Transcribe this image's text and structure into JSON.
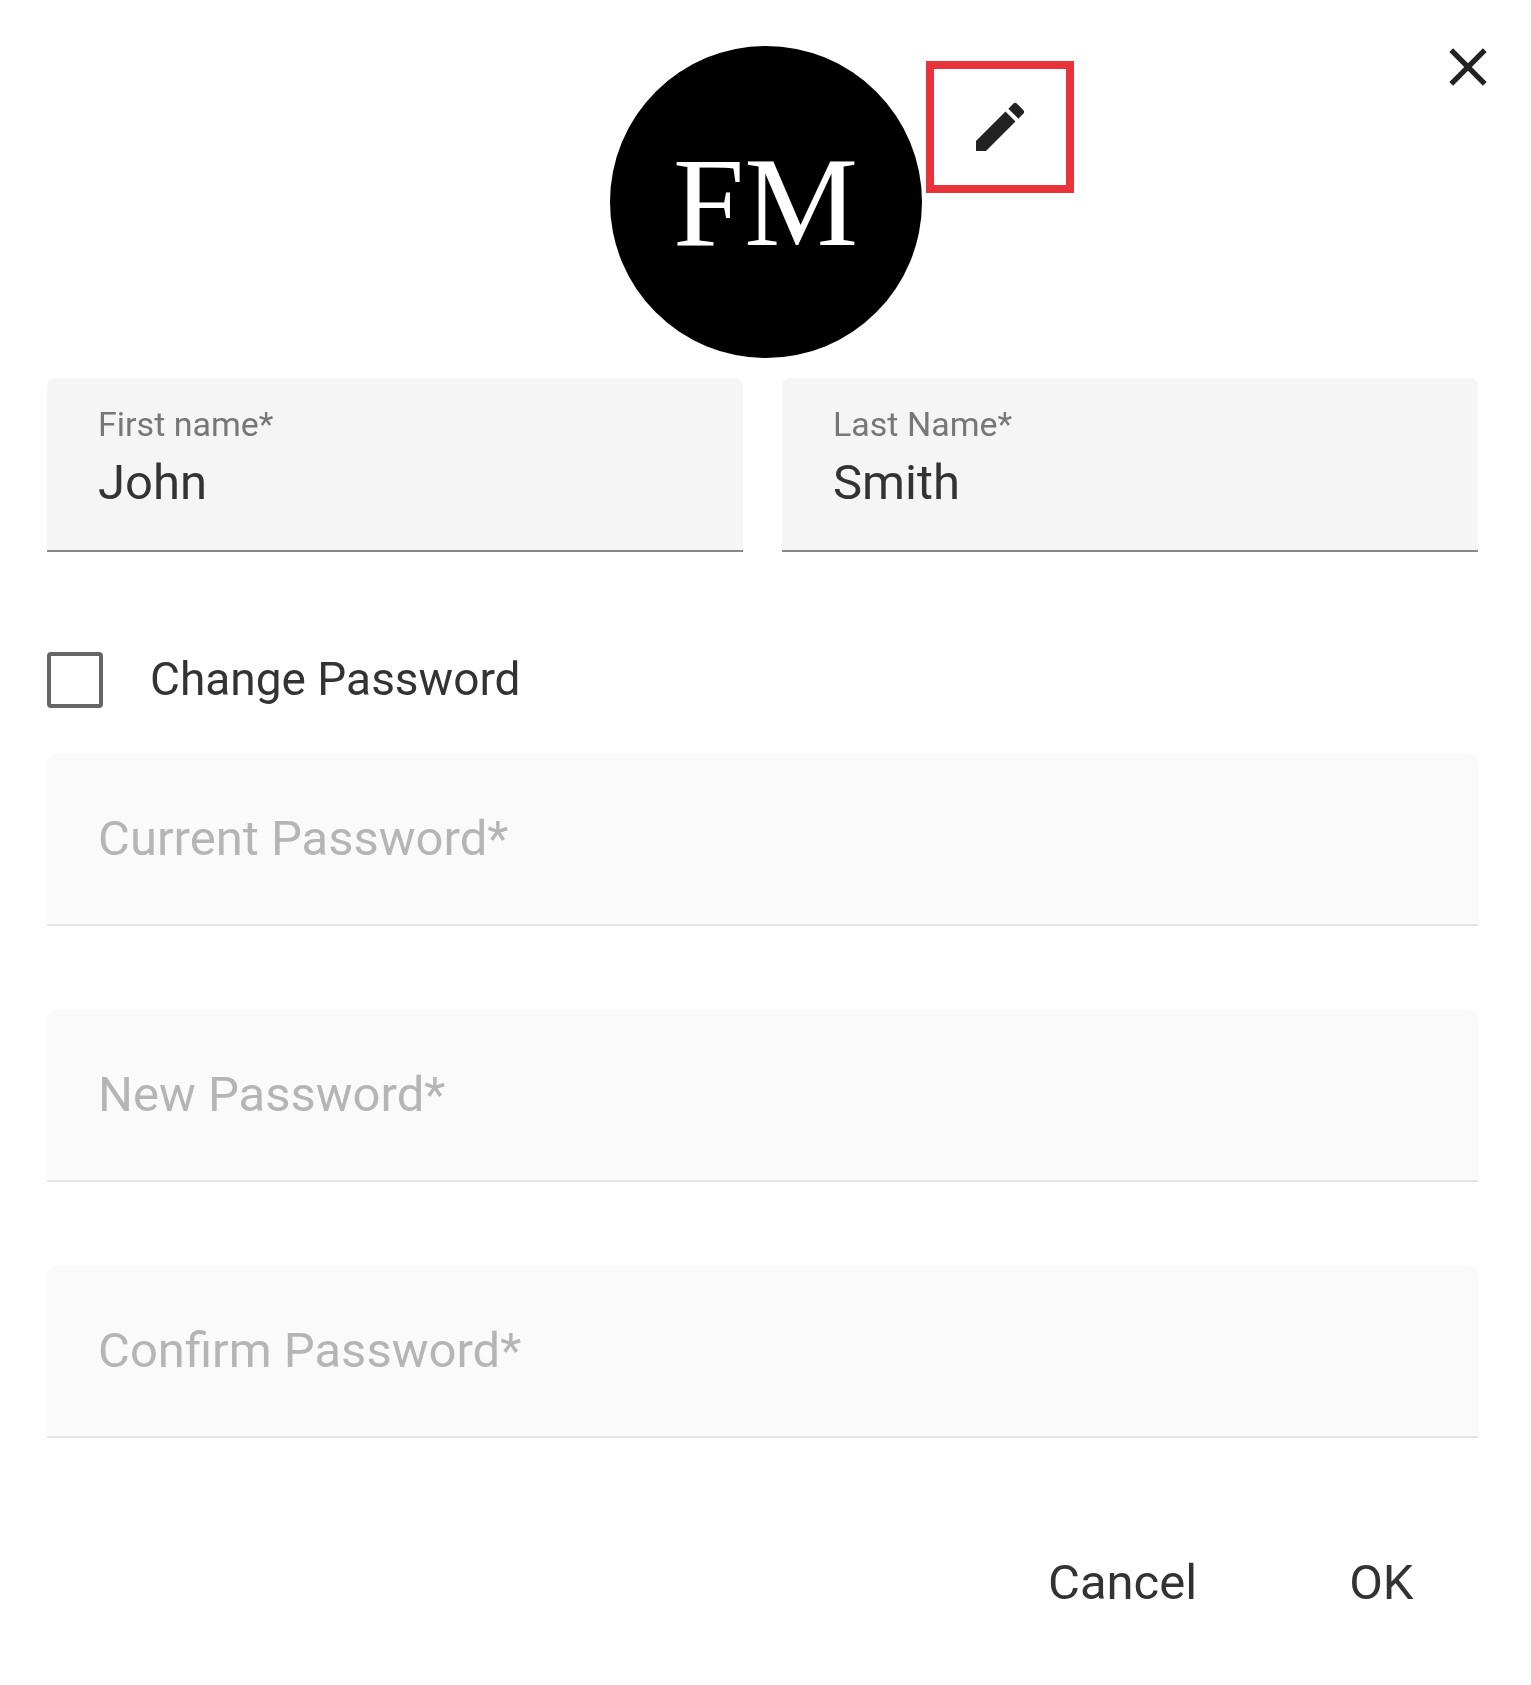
{
  "avatar": {
    "initials": "FM"
  },
  "edit_button": {
    "highlighted": true
  },
  "name_fields": [
    {
      "label": "First name*",
      "value": "John"
    },
    {
      "label": "Last Name*",
      "value": "Smith"
    }
  ],
  "change_password": {
    "label": "Change Password",
    "checked": false
  },
  "password_fields": [
    {
      "placeholder": "Current Password*",
      "disabled": true
    },
    {
      "placeholder": "New Password*",
      "disabled": true
    },
    {
      "placeholder": "Confirm Password*",
      "disabled": true
    }
  ],
  "buttons": [
    "Cancel",
    "OK"
  ]
}
